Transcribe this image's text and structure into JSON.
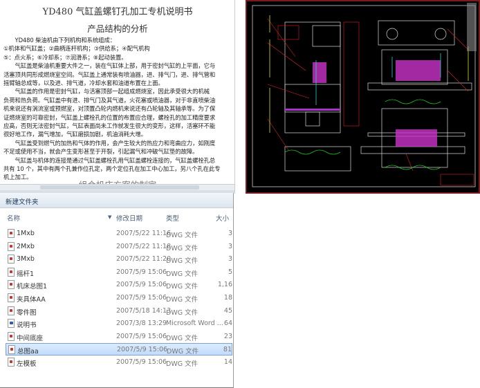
{
  "document": {
    "title": "YD480 气缸盖螺钉孔加工专机说明书",
    "subtitle": "产品结构的分析",
    "lines": [
      "　　YD480 柴油机由下列机构和系统组成：",
      "①机体和气缸盖；②曲柄连杆机构；③供给系；④配气机构",
      "⑤：点火系；⑥冷却系；⑦润滑系；⑧起动装置。",
      "　　气缸盖是柴油机重要大件之一，装在气缸体上部，用于密封气缸的上平面，它与",
      "活塞顶共同形成燃烧室空间。气缸盖上通常装有喷油器，进、排气门，进、排气管和",
      "摇臂轴总成等，以及进、排气道，冷却水套和油道布置在上面。",
      "　　气缸盖的作用是密封气缸，与活塞顶部一起组成燃烧室，因此承受很大的机械",
      "负荷和热负荷。气缸盖中有进、排气门及其气道，火花塞或喷油器，对于非直喷柴油",
      "机来说还有涡流室或预燃室，对顶置凸轮内燃机来说还有凸轮轴及其轴承等。为了保",
      "证燃烧室的可靠密封，气缸盖上螺栓孔的位置的布置应合理，螺栓孔的加工精度要求",
      "应高，否则无法密封气缸，气缸表面尚未工作就发生很大的变形，这样，活塞环不能",
      "很好地工作，漏气增加，气缸磨损加剧，机油消耗大增。",
      "　　气缸盖受到燃气的加热和气体的作用，会产生较大的热应力和弯曲应力，如刚度",
      "不足或使用不当，就会产生变形甚至于开裂，引起漏气和冲破气缸垫的故障。",
      "　　气缸盖与机体的连接是通过气缸盖螺栓孔用气缸盖螺栓连接的，气缸盖螺栓孔总",
      "共有 10 个，其中有两个孔兼作位孔定，两个定位孔在加工中心加工，另八个孔在此专",
      "机上加工。"
    ],
    "next_heading": "组合机床方案的制定"
  },
  "explorer": {
    "toolbar_button": "新建文件夹",
    "columns": {
      "name": "名称",
      "date": "修改日期",
      "type": "类型",
      "size": "大小"
    },
    "files": [
      {
        "name": "1Mxb",
        "date": "2007/5/22 11:16",
        "type": "DWG 文件",
        "size": "3",
        "icon": "dwg-file-icon"
      },
      {
        "name": "2Mxb",
        "date": "2007/5/22 11:18",
        "type": "DWG 文件",
        "size": "3",
        "icon": "dwg-file-icon"
      },
      {
        "name": "3Mxb",
        "date": "2007/5/22 11:20",
        "type": "DWG 文件",
        "size": "3",
        "icon": "dwg-file-icon"
      },
      {
        "name": "摇杆1",
        "date": "2007/5/9 15:06",
        "type": "DWG 文件",
        "size": "5",
        "icon": "dwg-file-icon"
      },
      {
        "name": "机床总图1",
        "date": "2007/5/9 15:06",
        "type": "DWG 文件",
        "size": "1,16",
        "icon": "dwg-file-icon"
      },
      {
        "name": "夹具体AA",
        "date": "2007/5/9 15:06",
        "type": "DWG 文件",
        "size": "18",
        "icon": "dwg-file-icon"
      },
      {
        "name": "零件图",
        "date": "2007/5/18 14:13",
        "type": "DWG 文件",
        "size": "45",
        "icon": "dwg-file-icon"
      },
      {
        "name": "说明书",
        "date": "2007/3/8 13:29",
        "type": "Microsoft Word ...",
        "size": "64",
        "icon": "word-file-icon"
      },
      {
        "name": "中间底座",
        "date": "2007/5/9 15:06",
        "type": "DWG 文件",
        "size": "23",
        "icon": "dwg-file-icon"
      },
      {
        "name": "总图aa",
        "date": "2007/5/9 15:06",
        "type": "DWG 文件",
        "size": "81",
        "icon": "dwg-file-icon",
        "selected": true
      },
      {
        "name": "左模板",
        "date": "2007/5/9 15:06",
        "type": "DWG 文件",
        "size": "14",
        "icon": "dwg-file-icon"
      }
    ]
  },
  "cad": {
    "background": "#000000",
    "frame_color": "#7a1a1a"
  }
}
